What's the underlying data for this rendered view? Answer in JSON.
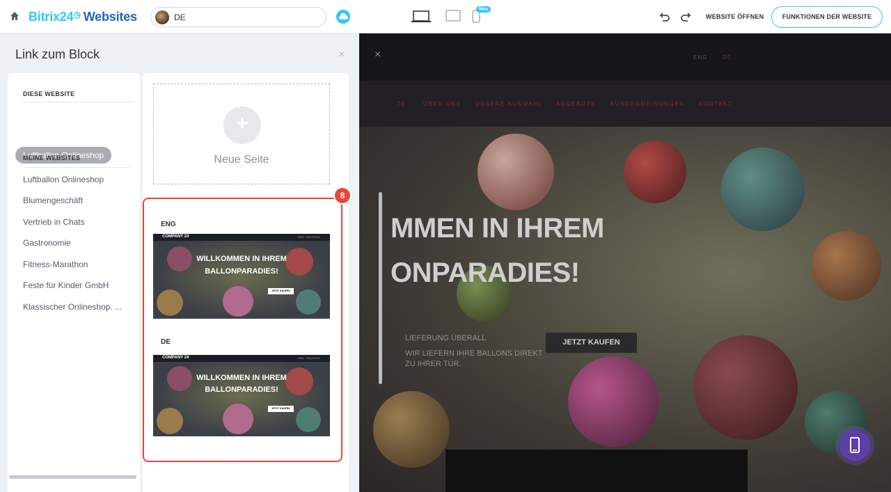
{
  "topbar": {
    "brand_a": "Bitrix24",
    "brand_clock": "◷",
    "brand_b": "Websites",
    "site_lang": "DE",
    "new_badge": "Neu",
    "open_site": "WEBSITE ÖFFNEN",
    "functions": "FUNKTIONEN DER WEBSITE"
  },
  "panel": {
    "title": "Link zum Block",
    "close": "×",
    "this_site_header": "DIESE WEBSITE",
    "this_site_pill": "Luftballon Onlineshop",
    "my_sites_header": "MEINE WEBSITES",
    "my_sites": [
      "Luftballon Onlineshop",
      "Blumengeschäft",
      "Vertrieb in Chats",
      "Gastronomie",
      "Fitness-Marathon",
      "Feste für Kinder GmbH",
      "Klassischer Onlineshop. ..."
    ],
    "new_page_plus": "+",
    "new_page_label": "Neue Seite",
    "step_badge": "8",
    "pages": [
      {
        "label": "ENG",
        "company": "COMPANY 24",
        "lang": "ENG  ·  DEUTSCH",
        "title_1": "WILLKOMMEN IN IHREM",
        "title_2": "BALLONPARADIES!",
        "button": "JETZT KAUFEN"
      },
      {
        "label": "DE",
        "company": "COMPANY 24",
        "lang": "ENG  ·  DEUTSCH",
        "title_1": "WILLKOMMEN IN IHREM",
        "title_2": "BALLONPARADIES!",
        "button": "JETZT KAUFEN"
      }
    ]
  },
  "preview": {
    "close": "×",
    "lang_eng": "ENG",
    "lang_de": "DE",
    "nav": [
      "TE",
      "ÜBER UNS",
      "UNSERE AUSWAHL",
      "ANGEBOTE",
      "KUNDENMEINUNGEN",
      "KONTAKT"
    ],
    "hero_line1": "MMEN IN IHREM",
    "hero_line2": "ONPARADIES!",
    "delivery": "LIEFERUNG ÜBERALL",
    "delivery_sub_1": "WIR LIEFERN IHRE BALLONS DIREKT",
    "delivery_sub_2": "ZU IHRER TÜR.",
    "buy_button": "JETZT KAUFEN"
  }
}
